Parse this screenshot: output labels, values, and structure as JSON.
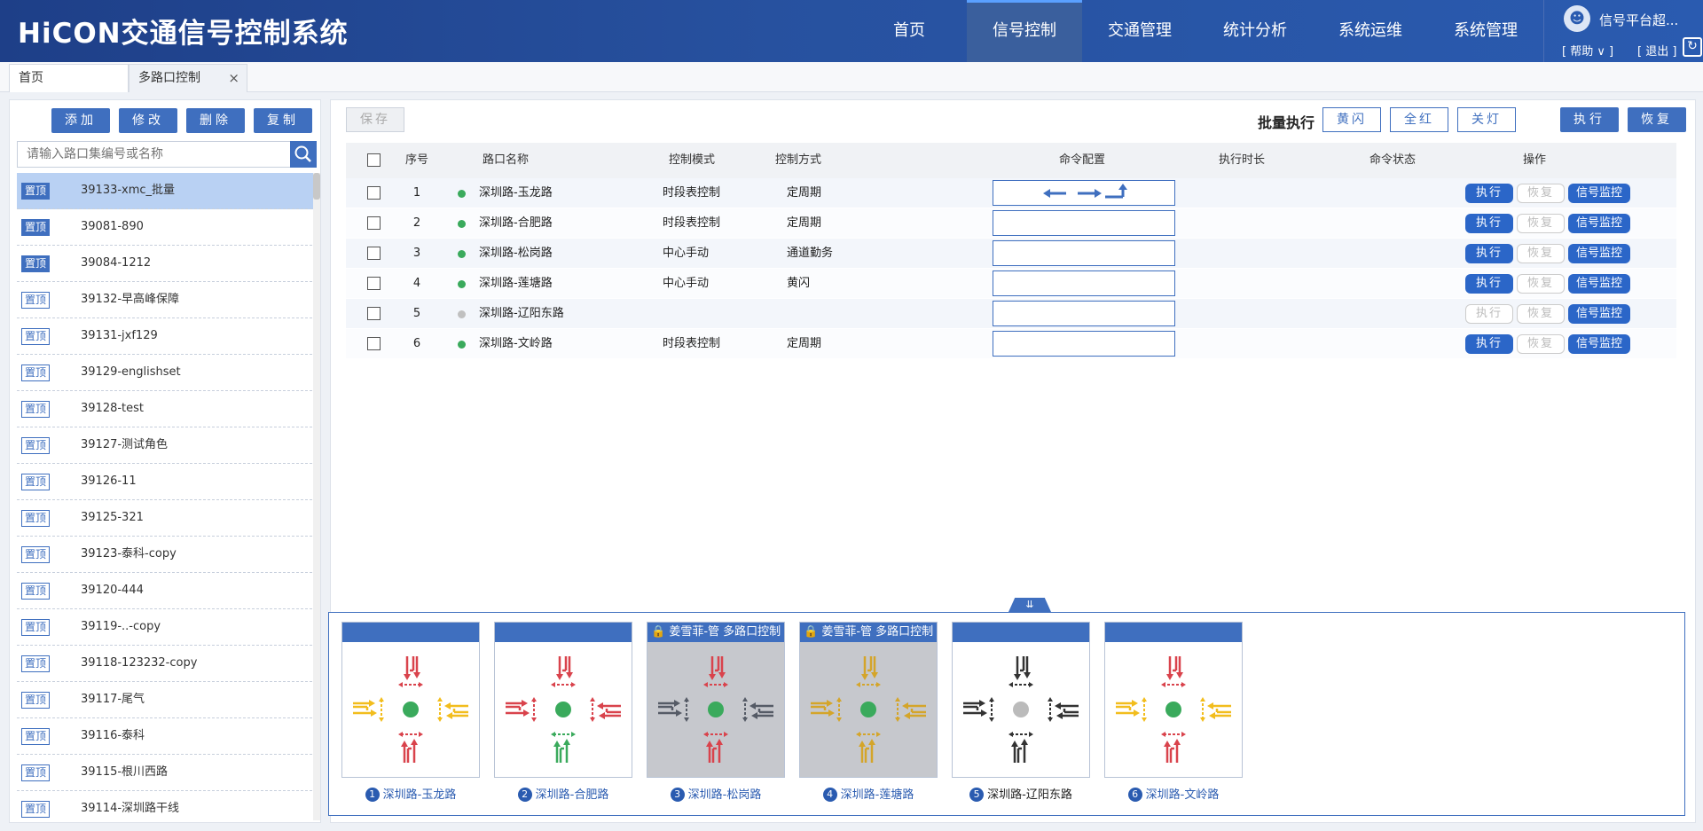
{
  "app": {
    "title": "HiCON交通信号控制系统"
  },
  "nav": {
    "items": [
      "首页",
      "信号控制",
      "交通管理",
      "统计分析",
      "系统运维",
      "系统管理"
    ],
    "active": 1
  },
  "user": {
    "name": "信号平台超...",
    "help": "[ 帮助 ∨ ]",
    "logout": "[ 退出 ]"
  },
  "tabs": [
    {
      "label": "首页"
    },
    {
      "label": "多路口控制",
      "close": "×"
    }
  ],
  "left": {
    "buttons": [
      "添加",
      "修改",
      "删除",
      "复制"
    ],
    "search_placeholder": "请输入路口集编号或名称",
    "pin_label": "置顶",
    "items": [
      {
        "label": "39133-xmc_批量",
        "pinned": true,
        "selected": true
      },
      {
        "label": "39081-890",
        "pinned": true
      },
      {
        "label": "39084-1212",
        "pinned": true
      },
      {
        "label": "39132-早高峰保障"
      },
      {
        "label": "39131-jxf129"
      },
      {
        "label": "39129-englishset"
      },
      {
        "label": "39128-test"
      },
      {
        "label": "39127-测试角色"
      },
      {
        "label": "39126-11"
      },
      {
        "label": "39125-321"
      },
      {
        "label": "39123-泰科-copy"
      },
      {
        "label": "39120-444"
      },
      {
        "label": "39119-..-copy"
      },
      {
        "label": "39118-123232-copy"
      },
      {
        "label": "39117-尾气"
      },
      {
        "label": "39116-泰科"
      },
      {
        "label": "39115-根川西路"
      },
      {
        "label": "39114-深圳路干线"
      }
    ]
  },
  "toolbar": {
    "save": "保存",
    "batch_label": "批量执行",
    "yellow_flash": "黄闪",
    "all_red": "全红",
    "lights_off": "关灯",
    "execute": "执行",
    "restore": "恢复"
  },
  "table": {
    "headers": [
      "序号",
      "路口名称",
      "控制模式",
      "控制方式",
      "命令配置",
      "执行时长",
      "命令状态",
      "操作"
    ],
    "op_labels": {
      "execute": "执行",
      "restore": "恢复",
      "monitor": "信号监控"
    },
    "rows": [
      {
        "no": "1",
        "name": "深圳路-玉龙路",
        "mode": "时段表控制",
        "method": "定周期",
        "online": true,
        "exec_enabled": true,
        "has_cmd": true
      },
      {
        "no": "2",
        "name": "深圳路-合肥路",
        "mode": "时段表控制",
        "method": "定周期",
        "online": true,
        "exec_enabled": true
      },
      {
        "no": "3",
        "name": "深圳路-松岗路",
        "mode": "中心手动",
        "method": "通道勤务",
        "online": true,
        "exec_enabled": true
      },
      {
        "no": "4",
        "name": "深圳路-莲塘路",
        "mode": "中心手动",
        "method": "黄闪",
        "online": true,
        "exec_enabled": true
      },
      {
        "no": "5",
        "name": "深圳路-辽阳东路",
        "mode": "",
        "method": "",
        "online": false,
        "exec_enabled": false
      },
      {
        "no": "6",
        "name": "深圳路-文岭路",
        "mode": "时段表控制",
        "method": "定周期",
        "online": true,
        "exec_enabled": true
      }
    ]
  },
  "cards": [
    {
      "num": "1",
      "name": "深圳路-玉龙路",
      "header": "",
      "locked": false,
      "center": "#3aaa5c",
      "colors": {
        "n": "#d9434c",
        "s": "#d9434c",
        "w": "#f2bd1d",
        "e": "#f2bd1d"
      }
    },
    {
      "num": "2",
      "name": "深圳路-合肥路",
      "header": "",
      "locked": false,
      "center": "#3aaa5c",
      "colors": {
        "n": "#d9434c",
        "s": "#3aaa5c",
        "w": "#d9434c",
        "e": "#d9434c"
      }
    },
    {
      "num": "3",
      "name": "深圳路-松岗路",
      "header": "姜雪菲-管 多路口控制",
      "locked": true,
      "center": "#3aaa5c",
      "colors": {
        "n": "#d9434c",
        "s": "#d9434c",
        "w": "#555b66",
        "e": "#555b66"
      }
    },
    {
      "num": "4",
      "name": "深圳路-莲塘路",
      "header": "姜雪菲-管 多路口控制",
      "locked": true,
      "center": "#3aaa5c",
      "colors": {
        "n": "#d4a52a",
        "s": "#d4a52a",
        "w": "#d4a52a",
        "e": "#d4a52a"
      }
    },
    {
      "num": "5",
      "name": "深圳路-辽阳东路",
      "header": "",
      "locked": false,
      "center": "#bbbbbb",
      "dark": true,
      "colors": {
        "n": "#333333",
        "s": "#333333",
        "w": "#333333",
        "e": "#333333"
      }
    },
    {
      "num": "6",
      "name": "深圳路-文岭路",
      "header": "",
      "locked": false,
      "center": "#3aaa5c",
      "colors": {
        "n": "#d9434c",
        "s": "#d9434c",
        "w": "#f2bd1d",
        "e": "#f2bd1d"
      }
    }
  ],
  "colors": {
    "brand": "#2a5bb0",
    "button": "#3f6fbf",
    "online": "#3aaa5c",
    "offline": "#c0c0c0"
  }
}
